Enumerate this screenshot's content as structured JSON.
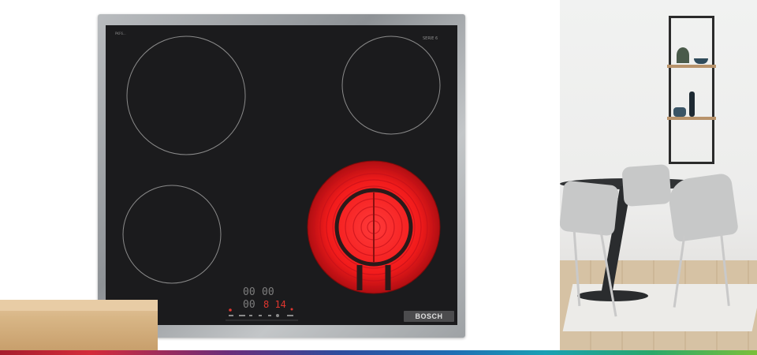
{
  "hob": {
    "brand": "BOSCH",
    "model_text": "PKF6...",
    "series_text": "SERIE 6",
    "display": {
      "left_top": "00",
      "right_top": "00",
      "left_bottom": "00",
      "right_bottom": "8 14"
    },
    "active_zone": "front-right"
  },
  "colors": {
    "glass": "#1b1b1d",
    "heating_glow": "#ff1a1a",
    "frame": "#a4a8ab",
    "display_red": "#e0362f"
  }
}
